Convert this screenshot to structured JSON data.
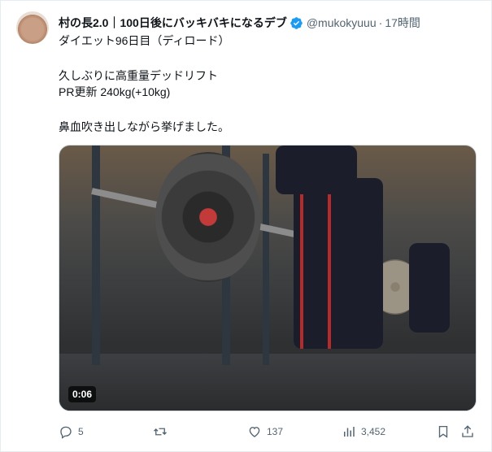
{
  "author": {
    "display_name": "村の長2.0｜100日後にバッキバキになるデブ",
    "handle": "@mukokyuuu",
    "separator": "·",
    "time": "17時間"
  },
  "tweet": {
    "lines": [
      "ダイエット96日目（ディロード）",
      "久しぶりに高重量デッドリフト",
      "PR更新 240kg(+10kg)",
      "鼻血吹き出しながら挙げました。"
    ]
  },
  "media": {
    "timestamp": "0:06"
  },
  "actions": {
    "replies": "5",
    "retweets": "",
    "likes": "137",
    "views": "3,452"
  },
  "colors": {
    "verified": "#1d9bf0",
    "muted": "#536471"
  }
}
